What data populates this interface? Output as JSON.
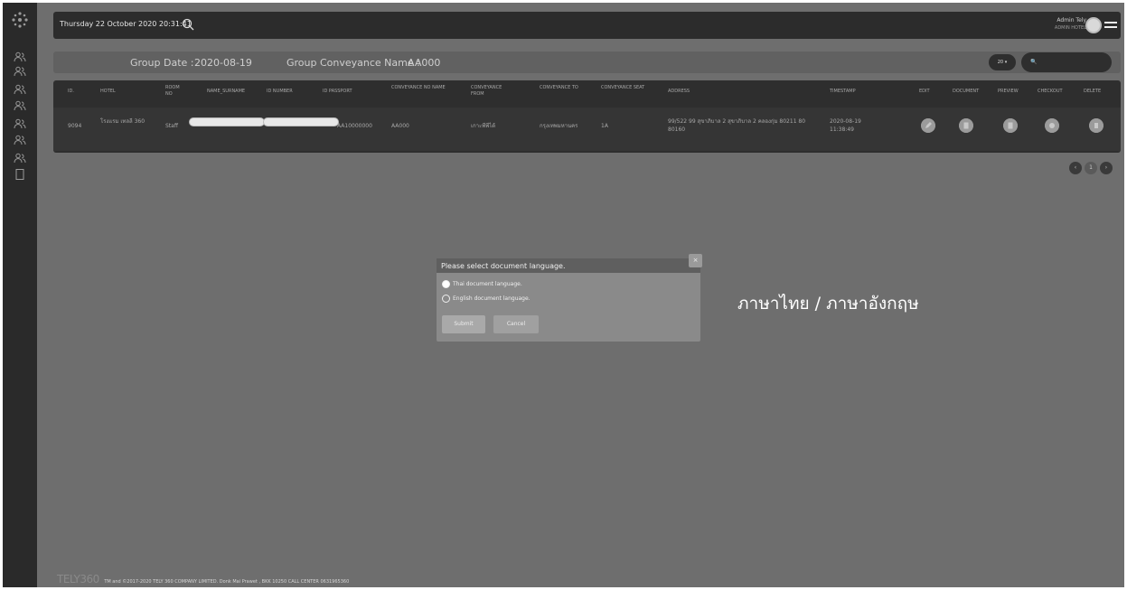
{
  "topbar": {
    "datetime": "Thursday 22 October 2020 20:31:41",
    "admin_name": "Admin Tely",
    "admin_hotel": "ADMIN HOTEL"
  },
  "group": {
    "date_label": "Group Date :",
    "date_value": "2020-08-19",
    "conveyance_label": "Group Conveyance Name :",
    "conveyance_value": "AA000",
    "page_size": "20",
    "search_placeholder": "🔍"
  },
  "table": {
    "headers": [
      "ID.",
      "HOTEL",
      "ROOM NO",
      "NAME_SURNAME",
      "ID NUMBER",
      "ID PASSPORT",
      "CONVEYANCE NO NAME",
      "CONVEYANCE FROM",
      "CONVEYANCE TO",
      "CONVEYANCE SEAT",
      "ADDRESS",
      "TIMESTAMP",
      "EDIT",
      "DOCUMENT",
      "PREVIEW",
      "CHECKOUT",
      "DELETE"
    ],
    "row": {
      "id": "9094",
      "hotel": "โรงแรม เทลลี 360",
      "room": "Staff",
      "passport": "AA10000000",
      "conveyance_no": "AA000",
      "from": "เกาะพีพีได้",
      "to": "กรุงเทพมหานคร",
      "seat": "1A",
      "address": "99/522 99 สุขาภิบาล 2 สุขาภิบาล 2 คลองกุ่ม 80211 80 80160",
      "timestamp": "2020-08-19 11:38:49"
    }
  },
  "pagination": {
    "prev": "‹",
    "current": "1",
    "next": "›"
  },
  "modal": {
    "title": "Please select document language.",
    "close": "×",
    "options": [
      {
        "label": "Thai document language.",
        "selected": true
      },
      {
        "label": "English document language.",
        "selected": false
      }
    ],
    "submit": "Submit",
    "cancel": "Cancel"
  },
  "annotation": "ภาษาไทย / ภาษาอังกฤษ",
  "footer": {
    "brand": "TELY360",
    "text": "TM and ©2017-2020 TELY 360 COMPANY LIMITED. Donk Mai Prawet , BKK 10250 CALL CENTER 0631965360"
  }
}
